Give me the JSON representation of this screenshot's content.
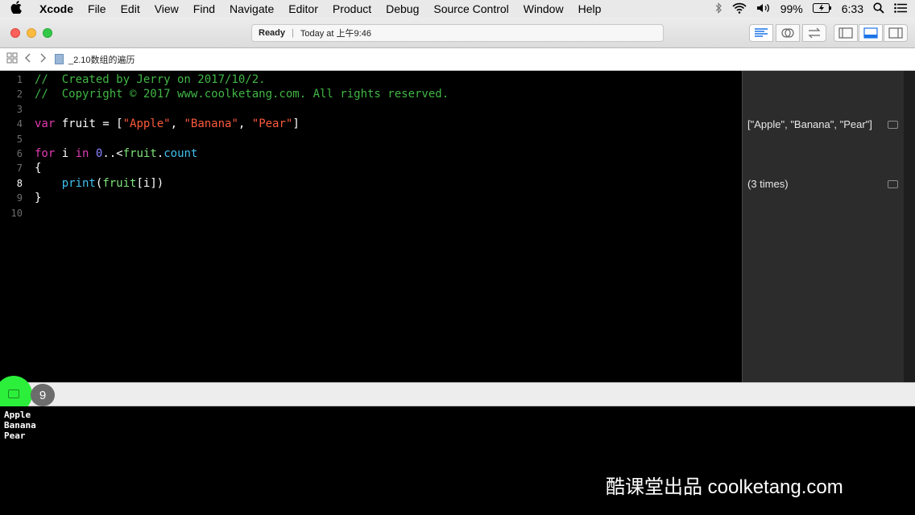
{
  "menubar": {
    "apple": "",
    "items": [
      "Xcode",
      "File",
      "Edit",
      "View",
      "Find",
      "Navigate",
      "Editor",
      "Product",
      "Debug",
      "Source Control",
      "Window",
      "Help"
    ],
    "battery": "99%",
    "time": "6:33",
    "status_icons": [
      "bluetooth-icon",
      "wifi-icon",
      "volume-icon",
      "battery-icon",
      "search-icon",
      "list-icon"
    ]
  },
  "toolbar": {
    "status": "Ready",
    "timestamp": "Today at 上午9:46"
  },
  "jumpbar": {
    "file": "_2.10数组的遍历"
  },
  "editor": {
    "line_numbers": [
      "1",
      "2",
      "3",
      "4",
      "5",
      "6",
      "7",
      "8",
      "9",
      "10"
    ],
    "current_line": "8"
  },
  "results": {
    "line4": "[\"Apple\", \"Banana\", \"Pear\"]",
    "line8": "(3 times)"
  },
  "debug": {
    "badge": "9"
  },
  "console": {
    "output": "Apple\nBanana\nPear"
  },
  "watermark": "酷课堂出品 coolketang.com",
  "colors": {
    "comment": "#41b645",
    "keyword": "#b21889",
    "string": "#fc5a3c",
    "number": "#8883ff",
    "function": "#41c2ef",
    "accent_green": "#2bef3a"
  }
}
